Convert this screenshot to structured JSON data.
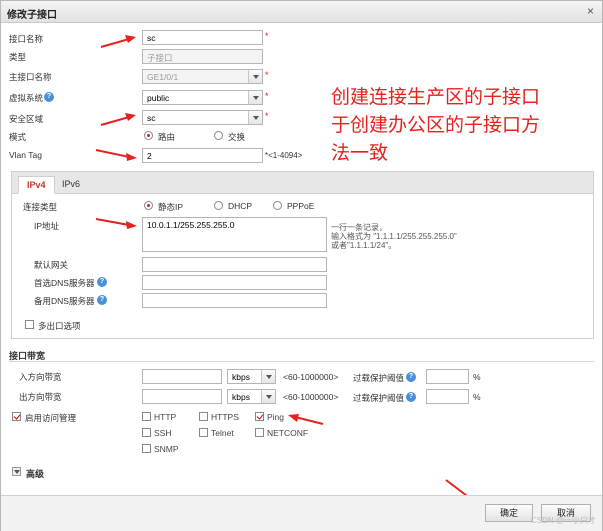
{
  "dialog": {
    "title": "修改子接口",
    "close_glyph": "×"
  },
  "form": {
    "name_label": "接口名称",
    "name_value": "sc",
    "name_star": "*",
    "type_label": "类型",
    "type_value": "子接口",
    "main_label": "主接口名称",
    "main_value": "GE1/0/1",
    "main_star": "*",
    "vsys_label": "虚拟系统",
    "vsys_value": "public",
    "vsys_star": "*",
    "zone_label": "安全区域",
    "zone_value": "sc",
    "zone_star": "*",
    "mode_label": "模式",
    "mode_route": "路由",
    "mode_switch": "交换",
    "vlan_label": "Vlan Tag",
    "vlan_value": "2",
    "vlan_hint": "*<1-4094>"
  },
  "tabs": [
    "IPv4",
    "IPv6"
  ],
  "ipv4": {
    "conn_label": "连接类型",
    "conn_options": [
      "静态IP",
      "DHCP",
      "PPPoE"
    ],
    "ip_label": "IP地址",
    "ip_value": "10.0.1.1/255.255.255.0",
    "ip_note1": "一行一条记录，",
    "ip_note2": "输入格式为 \"1.1.1.1/255.255.255.0\"",
    "ip_note3": "或者\"1.1.1.1/24\"。",
    "gw_label": "默认网关",
    "dns1_label": "首选DNS服务器",
    "dns2_label": "备用DNS服务器",
    "multi_label": "多出口选项"
  },
  "bandwidth": {
    "section": "接口带宽",
    "in_label": "入方向带宽",
    "out_label": "出方向带宽",
    "unit": "kbps",
    "range": "<60-1000000>",
    "threshold_label": "过载保护阈值",
    "percent": "%"
  },
  "access": {
    "label": "启用访问管理",
    "items": [
      "HTTP",
      "HTTPS",
      "Ping",
      "SSH",
      "Telnet",
      "NETCONF",
      "SNMP"
    ]
  },
  "advanced": {
    "label": "高级"
  },
  "annotation": {
    "line1": "创建连接生产区的子接口",
    "line2": "于创建办公区的子接口方",
    "line3": "法一致"
  },
  "footer": {
    "ok": "确定",
    "cancel": "取消",
    "watermark": "CSDN @一小只才"
  },
  "colors": {
    "accent": "#c0392b",
    "annotation": "#e8201e",
    "arrow": "#e8201e",
    "help": "#4a90d9"
  },
  "help_glyph": "?"
}
